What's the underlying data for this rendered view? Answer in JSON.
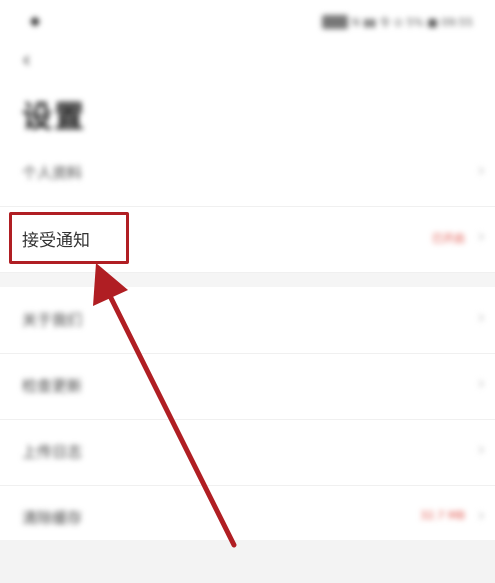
{
  "status_bar": {
    "left": "◆",
    "right": "N ▮▮ 令 ⊙ 5% ■ 09:55"
  },
  "nav": {
    "back": "‹"
  },
  "page_title": "设置",
  "settings": [
    {
      "label": "个人资料",
      "value": "",
      "chevron": "›"
    },
    {
      "label": "接受通知",
      "value": "已开启",
      "chevron": "›"
    },
    {
      "label": "关于我们",
      "value": "",
      "chevron": "›"
    },
    {
      "label": "检查更新",
      "value": "",
      "chevron": "›"
    },
    {
      "label": "上传日志",
      "value": "",
      "chevron": "›"
    },
    {
      "label": "清除缓存",
      "value": "32.7 MB",
      "chevron": "›"
    }
  ],
  "colors": {
    "highlight": "#b01e23",
    "accent_value": "#e0564d"
  }
}
